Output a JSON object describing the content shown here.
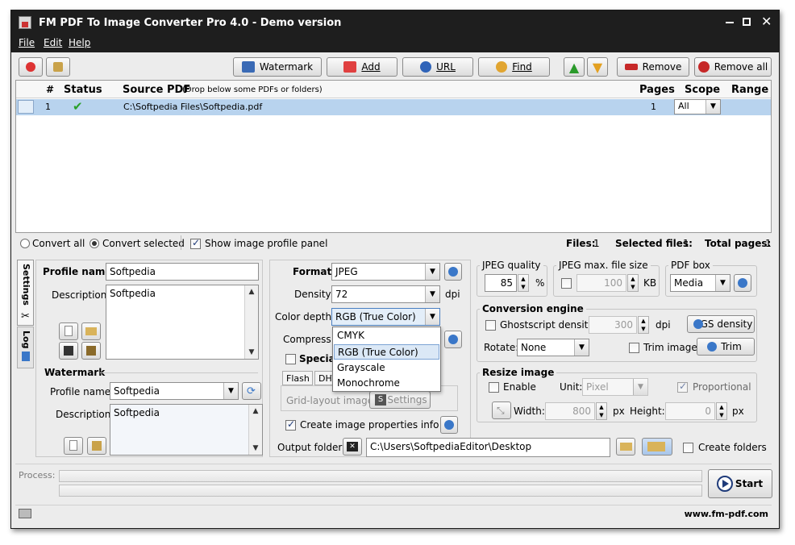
{
  "window": {
    "title": "FM PDF To Image Converter Pro 4.0 - Demo version"
  },
  "menu": [
    "File",
    "Edit",
    "Help"
  ],
  "toolbar": {
    "watermark": "Watermark",
    "add": "Add",
    "url": "URL",
    "find": "Find",
    "remove": "Remove",
    "remove_all": "Remove all"
  },
  "file_table": {
    "headers": {
      "num": "#",
      "status": "Status",
      "source": "Source PDF",
      "source_hint": "(Drop below some PDFs or folders)",
      "pages": "Pages",
      "scope": "Scope",
      "range": "Range"
    },
    "rows": [
      {
        "num": "1",
        "path": "C:\\Softpedia Files\\Softpedia.pdf",
        "pages": "1",
        "scope": "All",
        "range": ""
      }
    ]
  },
  "options_bar": {
    "convert_all": "Convert all",
    "convert_selected": "Convert selected",
    "show_profile": "Show image profile panel",
    "files_label": "Files:",
    "files": "1",
    "selected_label": "Selected files:",
    "selected": "1",
    "total_label": "Total pages:",
    "total": "1"
  },
  "side_tabs": {
    "settings": "Settings",
    "log": "Log"
  },
  "profile": {
    "name_label": "Profile name:",
    "name": "Softpedia",
    "desc_label": "Description:",
    "desc": "Softpedia"
  },
  "watermark_section": {
    "title": "Watermark",
    "profile_label": "Profile name:",
    "profile": "Softpedia",
    "desc_label": "Description:",
    "desc": "Softpedia"
  },
  "format_section": {
    "format_label": "Format:",
    "format": "JPEG",
    "density_label": "Density:",
    "density": "72",
    "density_unit": "dpi",
    "color_label": "Color depth:",
    "color": "RGB (True Color)",
    "color_options": [
      "CMYK",
      "RGB (True Color)",
      "Grayscale",
      "Monochrome"
    ],
    "compress_label": "Compress:",
    "special_label": "Special",
    "tab_flash": "Flash",
    "tab_dht": "DHT",
    "grid_label": "Grid-layout image",
    "grid_settings": "Settings",
    "create_info": "Create image properties info file",
    "output_label": "Output folder:",
    "output": "C:\\Users\\SoftpediaEditor\\Desktop",
    "create_folders": "Create folders"
  },
  "jpeg": {
    "quality_title": "JPEG quality",
    "quality": "85",
    "quality_unit": "%",
    "max_title": "JPEG max. file size",
    "max": "100",
    "max_unit": "KB",
    "pdfbox_title": "PDF box",
    "pdfbox": "Media"
  },
  "engine": {
    "title": "Conversion engine",
    "gs_label": "Ghostscript density:",
    "gs_value": "300",
    "gs_unit": "dpi",
    "gs_button": "GS density",
    "rotate_label": "Rotate:",
    "rotate": "None",
    "trim_label": "Trim image",
    "trim_button": "Trim"
  },
  "resize": {
    "title": "Resize image",
    "enable": "Enable",
    "unit_label": "Unit:",
    "unit": "Pixel",
    "proportional": "Proportional",
    "width_label": "Width:",
    "width": "800",
    "width_unit": "px",
    "height_label": "Height:",
    "height": "0",
    "height_unit": "px"
  },
  "process": {
    "label": "Process:",
    "start": "Start"
  },
  "status": {
    "website": "www.fm-pdf.com"
  },
  "colors": {
    "selection": "#b8d3ee",
    "title_bg": "#1e1e1e",
    "accent": "#3a77c8"
  }
}
